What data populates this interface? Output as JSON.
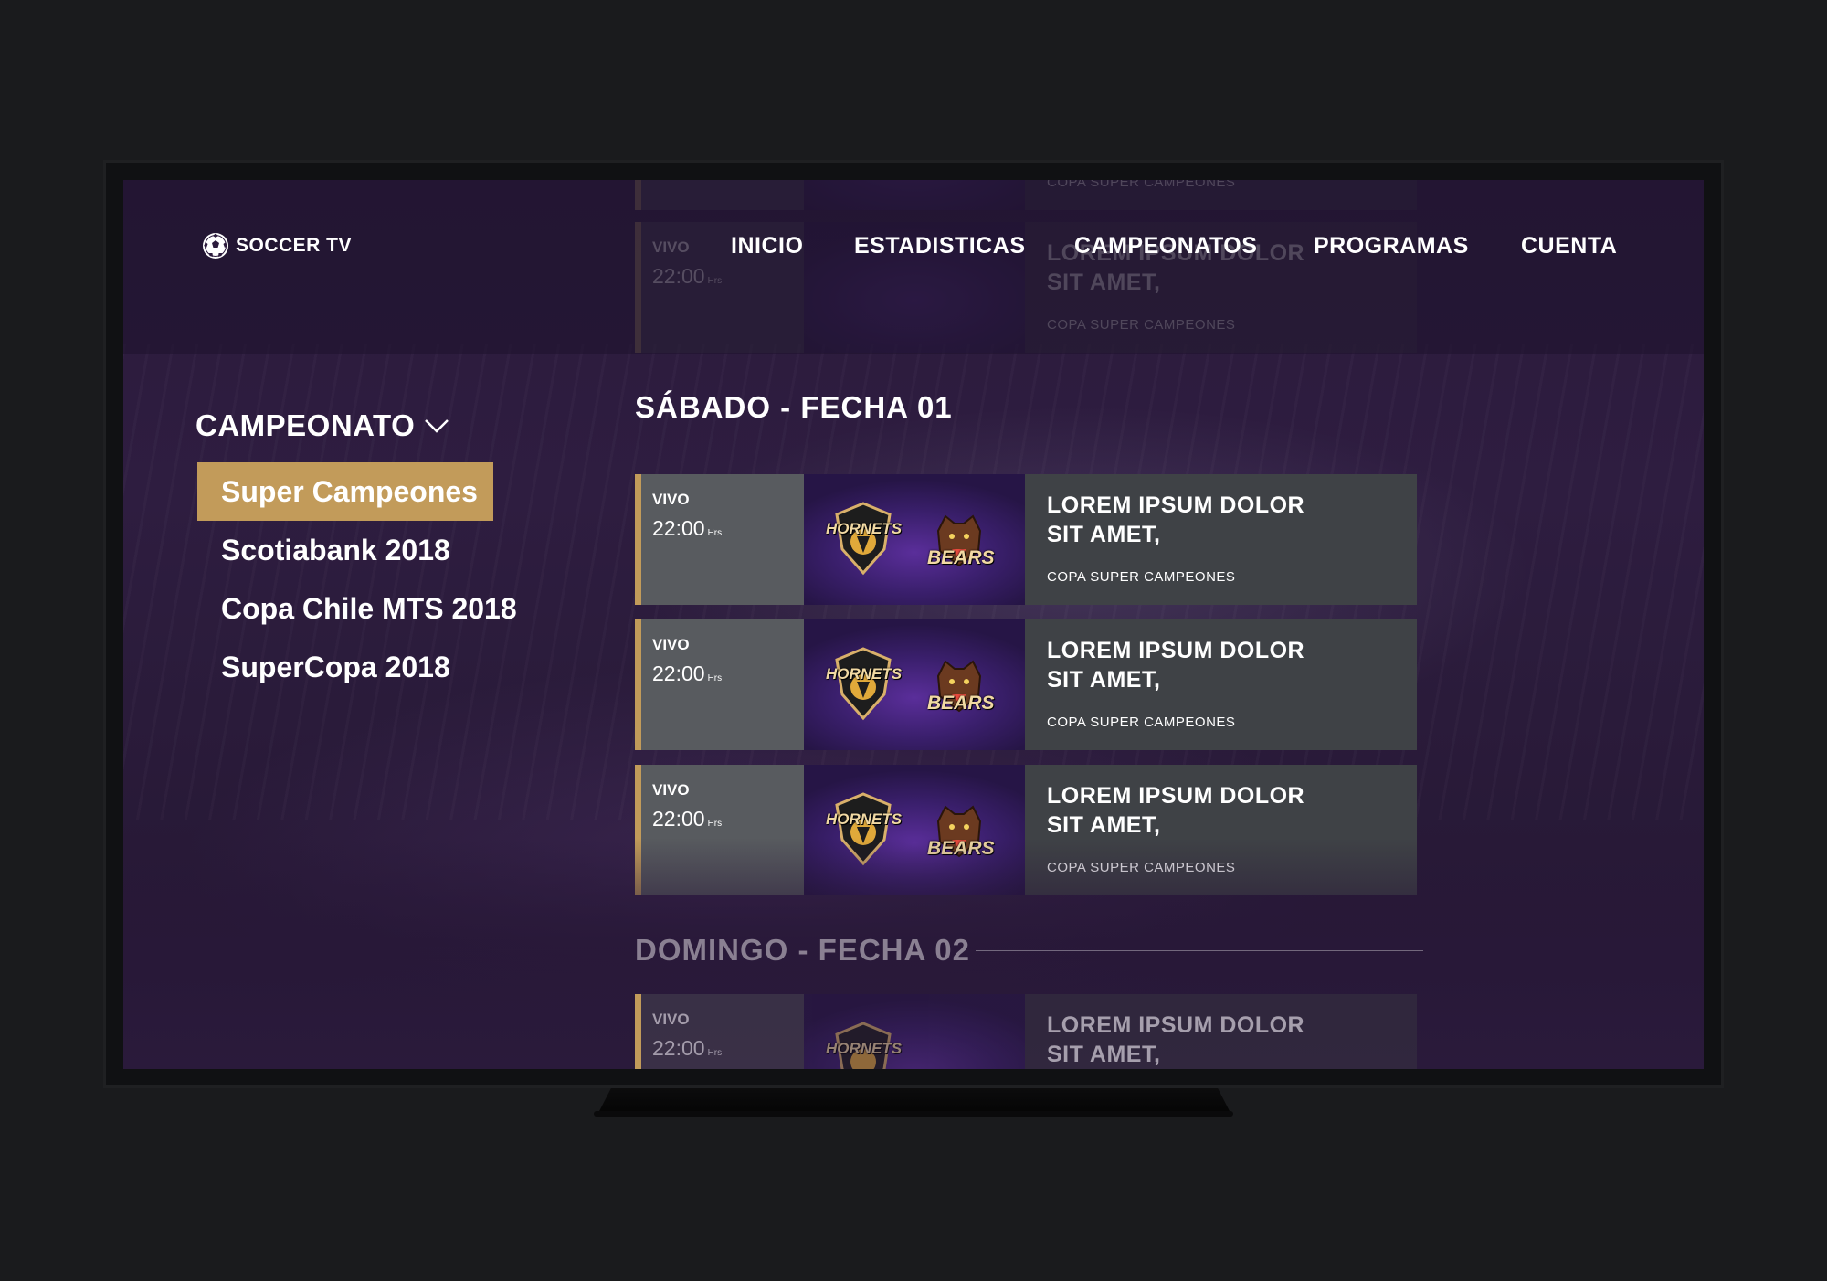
{
  "brand": {
    "name": "SOCCER TV",
    "icon": "soccer-ball-icon"
  },
  "nav": [
    "INICIO",
    "ESTADISTICAS",
    "CAMPEONATOS",
    "PROGRAMAS",
    "CUENTA"
  ],
  "sidebar": {
    "title": "CAMPEONATO",
    "title_icon": "chevron-down-icon",
    "items": [
      "Super Campeones",
      "Scotiabank 2018",
      "Copa Chile MTS 2018",
      "SuperCopa 2018"
    ],
    "active_index": 0
  },
  "sections": [
    {
      "title": "SÁBADO - FECHA 01"
    },
    {
      "title": "DOMINGO - FECHA 02"
    }
  ],
  "match": {
    "live_label": "VIVO",
    "time": "22:00",
    "time_unit": "Hrs",
    "headline_line1": "LOREM IPSUM DOLOR",
    "headline_line2": "SIT AMET,",
    "league": "COPA SUPER CAMPEONES",
    "home_team": "HORNETS",
    "away_team": "BEARS"
  },
  "colors": {
    "accent": "#c29b5a",
    "background": "#2b1a3c",
    "card_time": "#585b5f",
    "card_info": "#3f4246"
  }
}
